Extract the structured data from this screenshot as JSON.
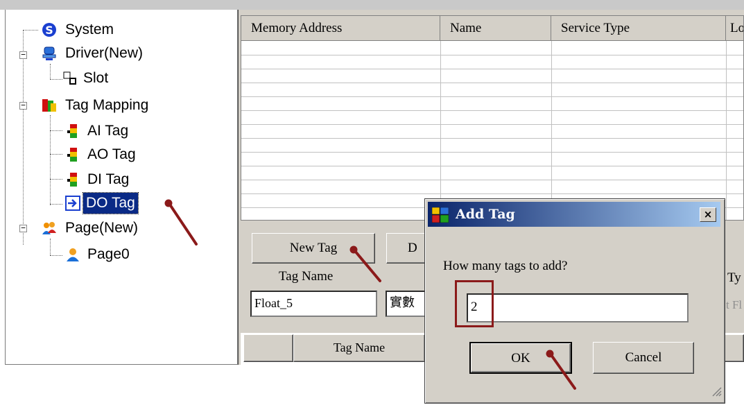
{
  "tree": {
    "items": [
      {
        "label": "System",
        "icon": "system-s-icon"
      },
      {
        "label": "Driver(New)",
        "icon": "driver-icon"
      },
      {
        "label": "Slot",
        "icon": "slot-icon"
      },
      {
        "label": "Tag Mapping",
        "icon": "tag-mapping-icon"
      },
      {
        "label": "AI Tag",
        "icon": "tag-bar-icon"
      },
      {
        "label": "AO Tag",
        "icon": "tag-bar-icon"
      },
      {
        "label": "DI Tag",
        "icon": "tag-bar-icon"
      },
      {
        "label": "DO Tag",
        "icon": "arrow-right-icon",
        "selected": true
      },
      {
        "label": "Page(New)",
        "icon": "page-group-icon"
      },
      {
        "label": "Page0",
        "icon": "user-page-icon"
      }
    ]
  },
  "grid": {
    "columns": [
      "Memory Address",
      "Name",
      "Service Type",
      "Lo"
    ]
  },
  "toolbar": {
    "new_tag_label": "New Tag",
    "partial_button_label": "D"
  },
  "form": {
    "tag_name_label": "Tag Name",
    "tag_name_value": "Float_5",
    "second_field_value": "實數",
    "type_label_partial": "Ty",
    "type_value_partial": "t Fl"
  },
  "bottom_table": {
    "header_tag_name": "Tag Name"
  },
  "dialog": {
    "title": "Add Tag",
    "close_label": "×",
    "prompt": "How many tags to add?",
    "input_value": "2",
    "ok_label": "OK",
    "cancel_label": "Cancel"
  },
  "colors": {
    "title_gradient_start": "#0a246a",
    "title_gradient_end": "#a6caf0",
    "selection": "#0a2a86",
    "annotation": "#8b1a1a"
  }
}
